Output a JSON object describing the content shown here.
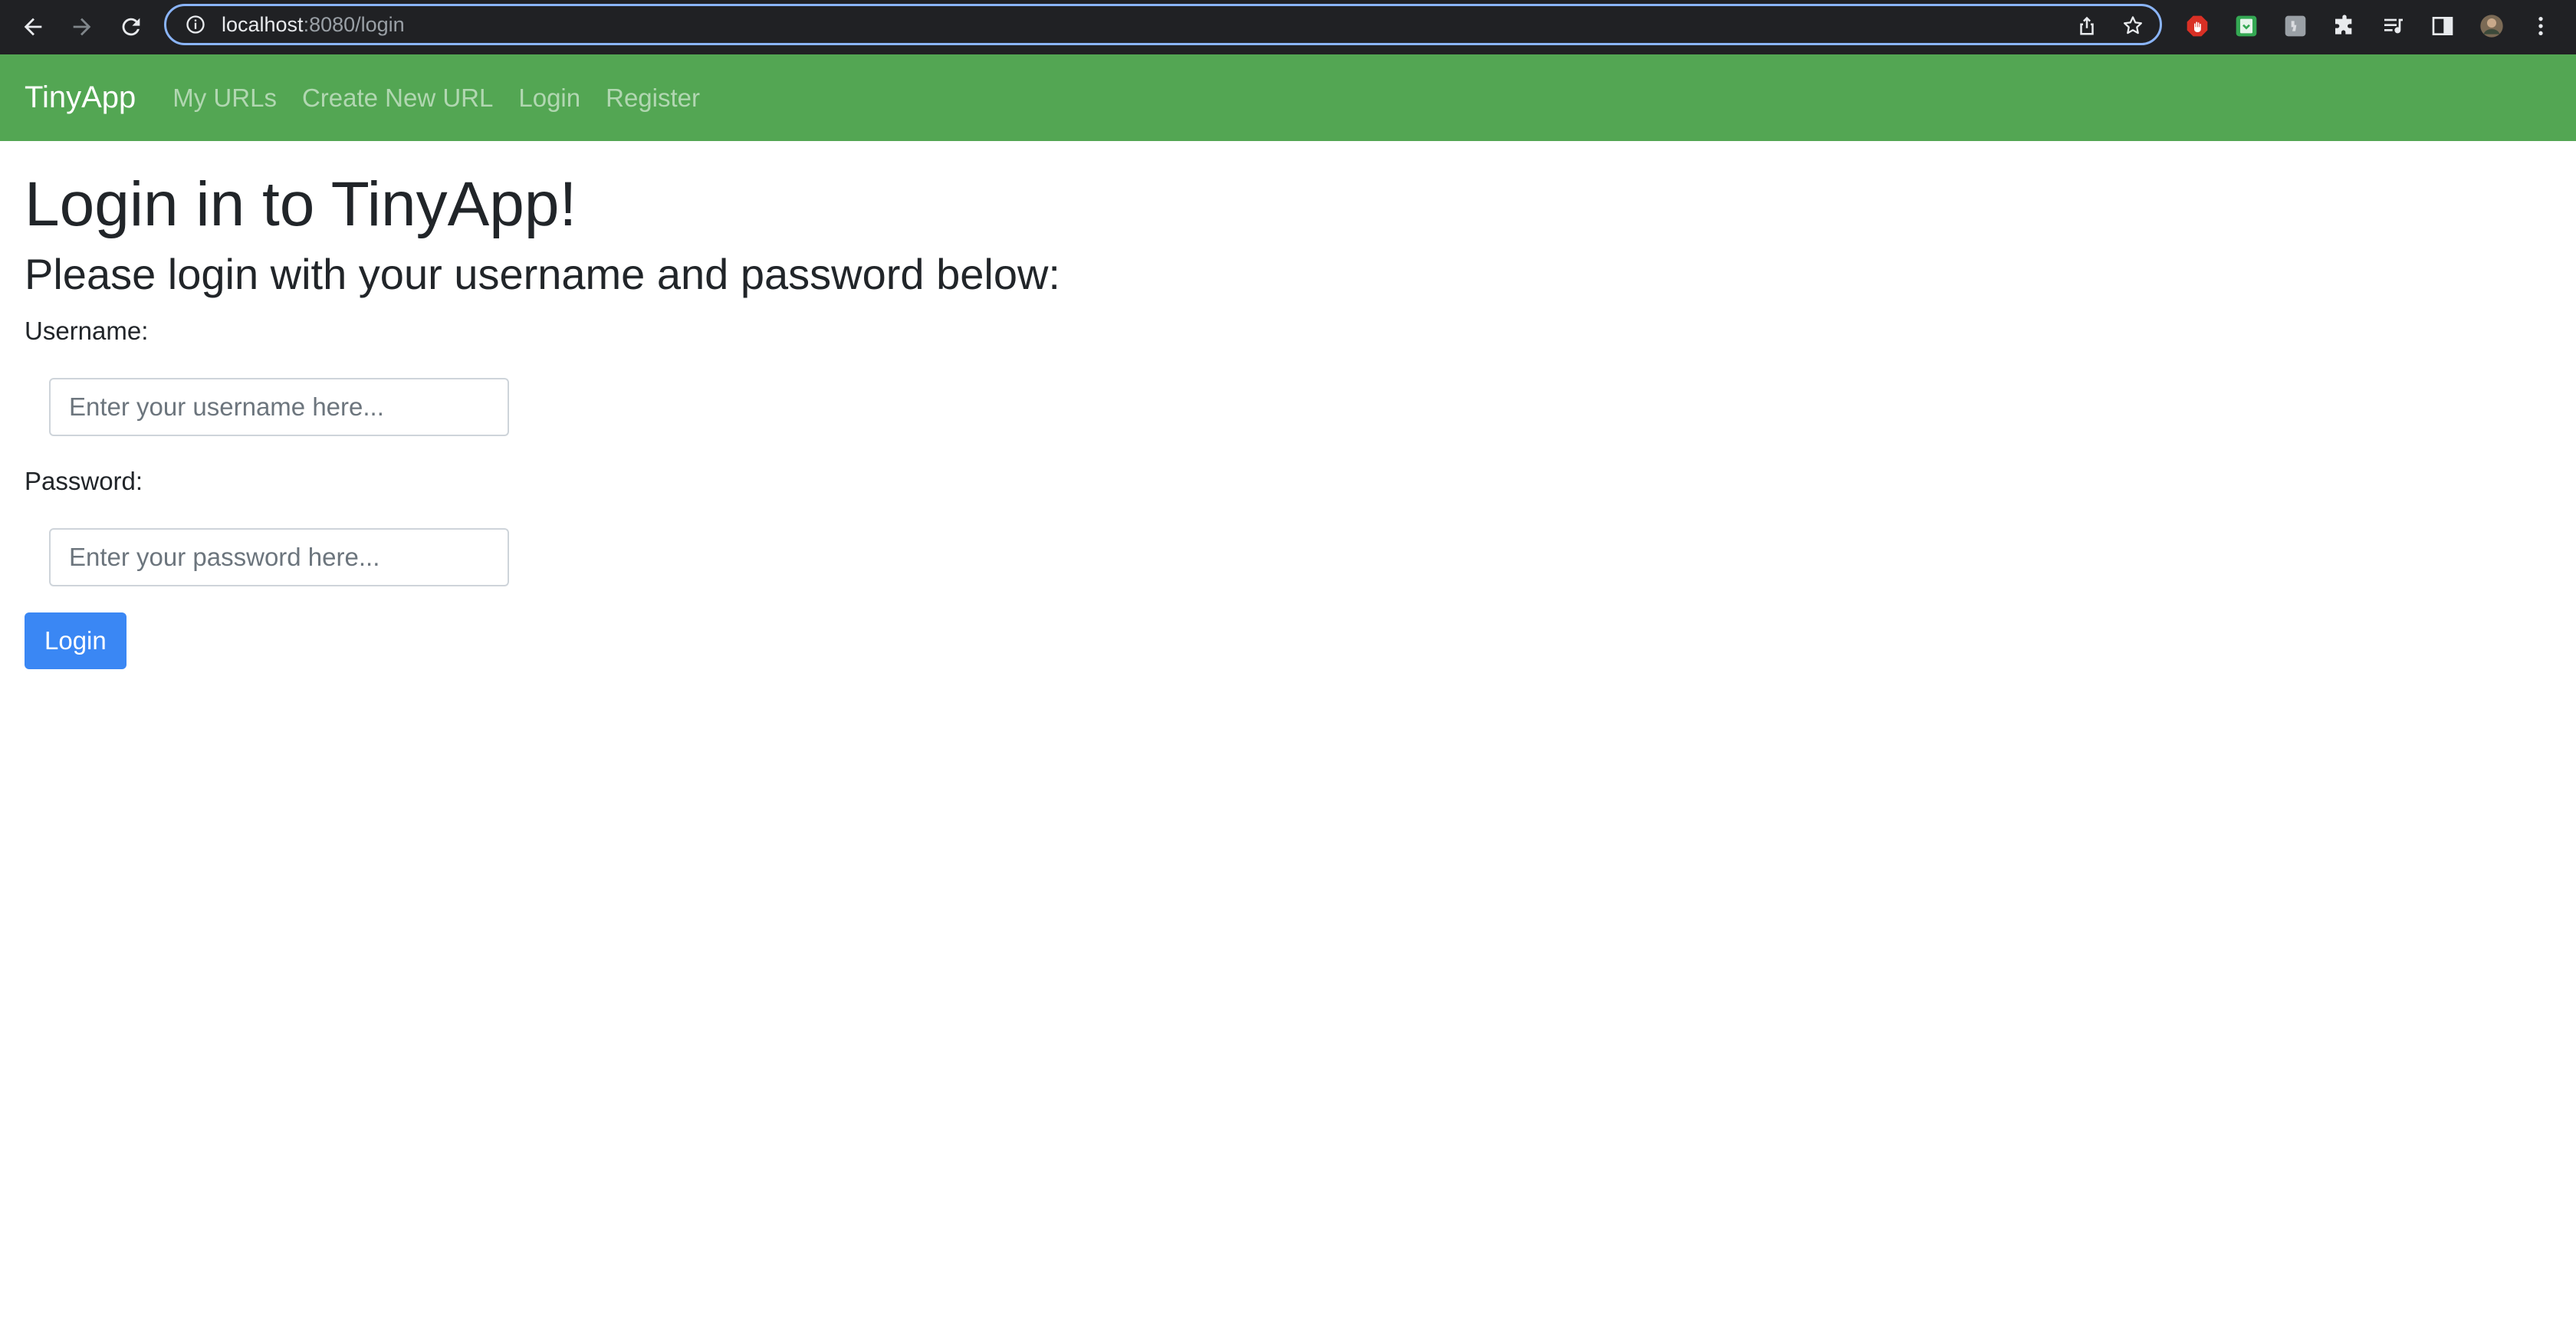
{
  "browser": {
    "url_host": "localhost",
    "url_path": ":8080/login",
    "icons": [
      "back-icon",
      "forward-icon",
      "reload-icon",
      "info-icon",
      "share-icon",
      "bookmark-star-icon",
      "adblock-extension-icon",
      "save-extension-icon",
      "grey-extension-icon",
      "extensions-puzzle-icon",
      "reading-list-icon",
      "side-panel-icon",
      "profile-avatar",
      "menu-kebab-icon"
    ]
  },
  "navbar": {
    "brand": "TinyApp",
    "links": [
      "My URLs",
      "Create New URL",
      "Login",
      "Register"
    ],
    "background": "#53a653"
  },
  "page": {
    "title": "Login in to TinyApp!",
    "subtitle": "Please login with your username and password below:"
  },
  "form": {
    "username_label": "Username:",
    "username_placeholder": "Enter your username here...",
    "password_label": "Password:",
    "password_placeholder": "Enter your password here...",
    "submit_label": "Login",
    "submit_color": "#3a87f4"
  }
}
